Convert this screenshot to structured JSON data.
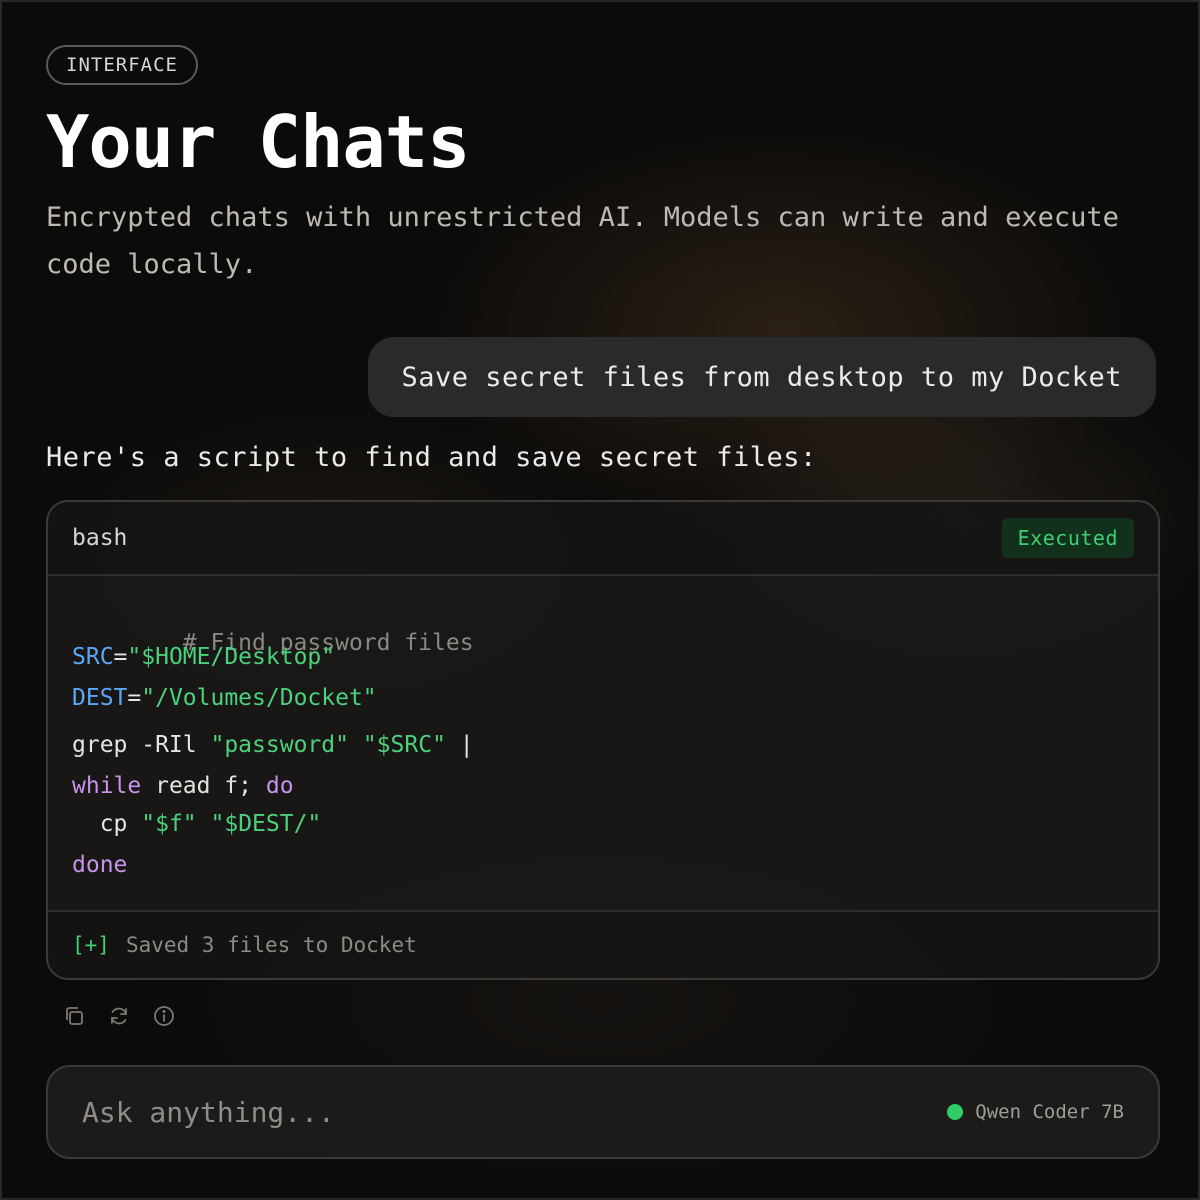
{
  "badge": "INTERFACE",
  "title": "Your Chats",
  "subtitle": "Encrypted chats with unrestricted AI. Models can write and execute code locally.",
  "user_message": "Save secret files from desktop to my Docket",
  "assistant_intro": "Here's a script to find and save secret files:",
  "code_block": {
    "language": "bash",
    "status": "Executed",
    "lines": {
      "l1": {
        "comment": "# Find password files"
      },
      "l2": {
        "var": "SRC",
        "op": "=",
        "str": "\"$HOME/Desktop\""
      },
      "l3": {
        "var": "DEST",
        "op": "=",
        "str": "\"/Volumes/Docket\""
      },
      "l4": {
        "cmd": "grep -RIl ",
        "str1": "\"password\"",
        "sp": " ",
        "str2": "\"$SRC\"",
        "pipe": " |"
      },
      "l5": {
        "kw1": "while",
        "mid": " read f; ",
        "kw2": "do"
      },
      "l6": {
        "cmd": "  cp ",
        "str1": "\"$f\"",
        "sp": " ",
        "str2": "\"$DEST/\""
      },
      "l7": {
        "kw": "done"
      }
    },
    "output_mark": "[+]",
    "output_text": "Saved 3 files to Docket"
  },
  "actions": {
    "copy_icon": "copy-icon",
    "regenerate_icon": "refresh-icon",
    "info_icon": "info-icon"
  },
  "input": {
    "placeholder": "Ask anything...",
    "model": "Qwen Coder 7B",
    "model_status_color": "#2ecc64"
  },
  "colors": {
    "accent_green": "#3fcf71",
    "variable_blue": "#5ba7f7",
    "keyword_purple": "#c792ea"
  }
}
